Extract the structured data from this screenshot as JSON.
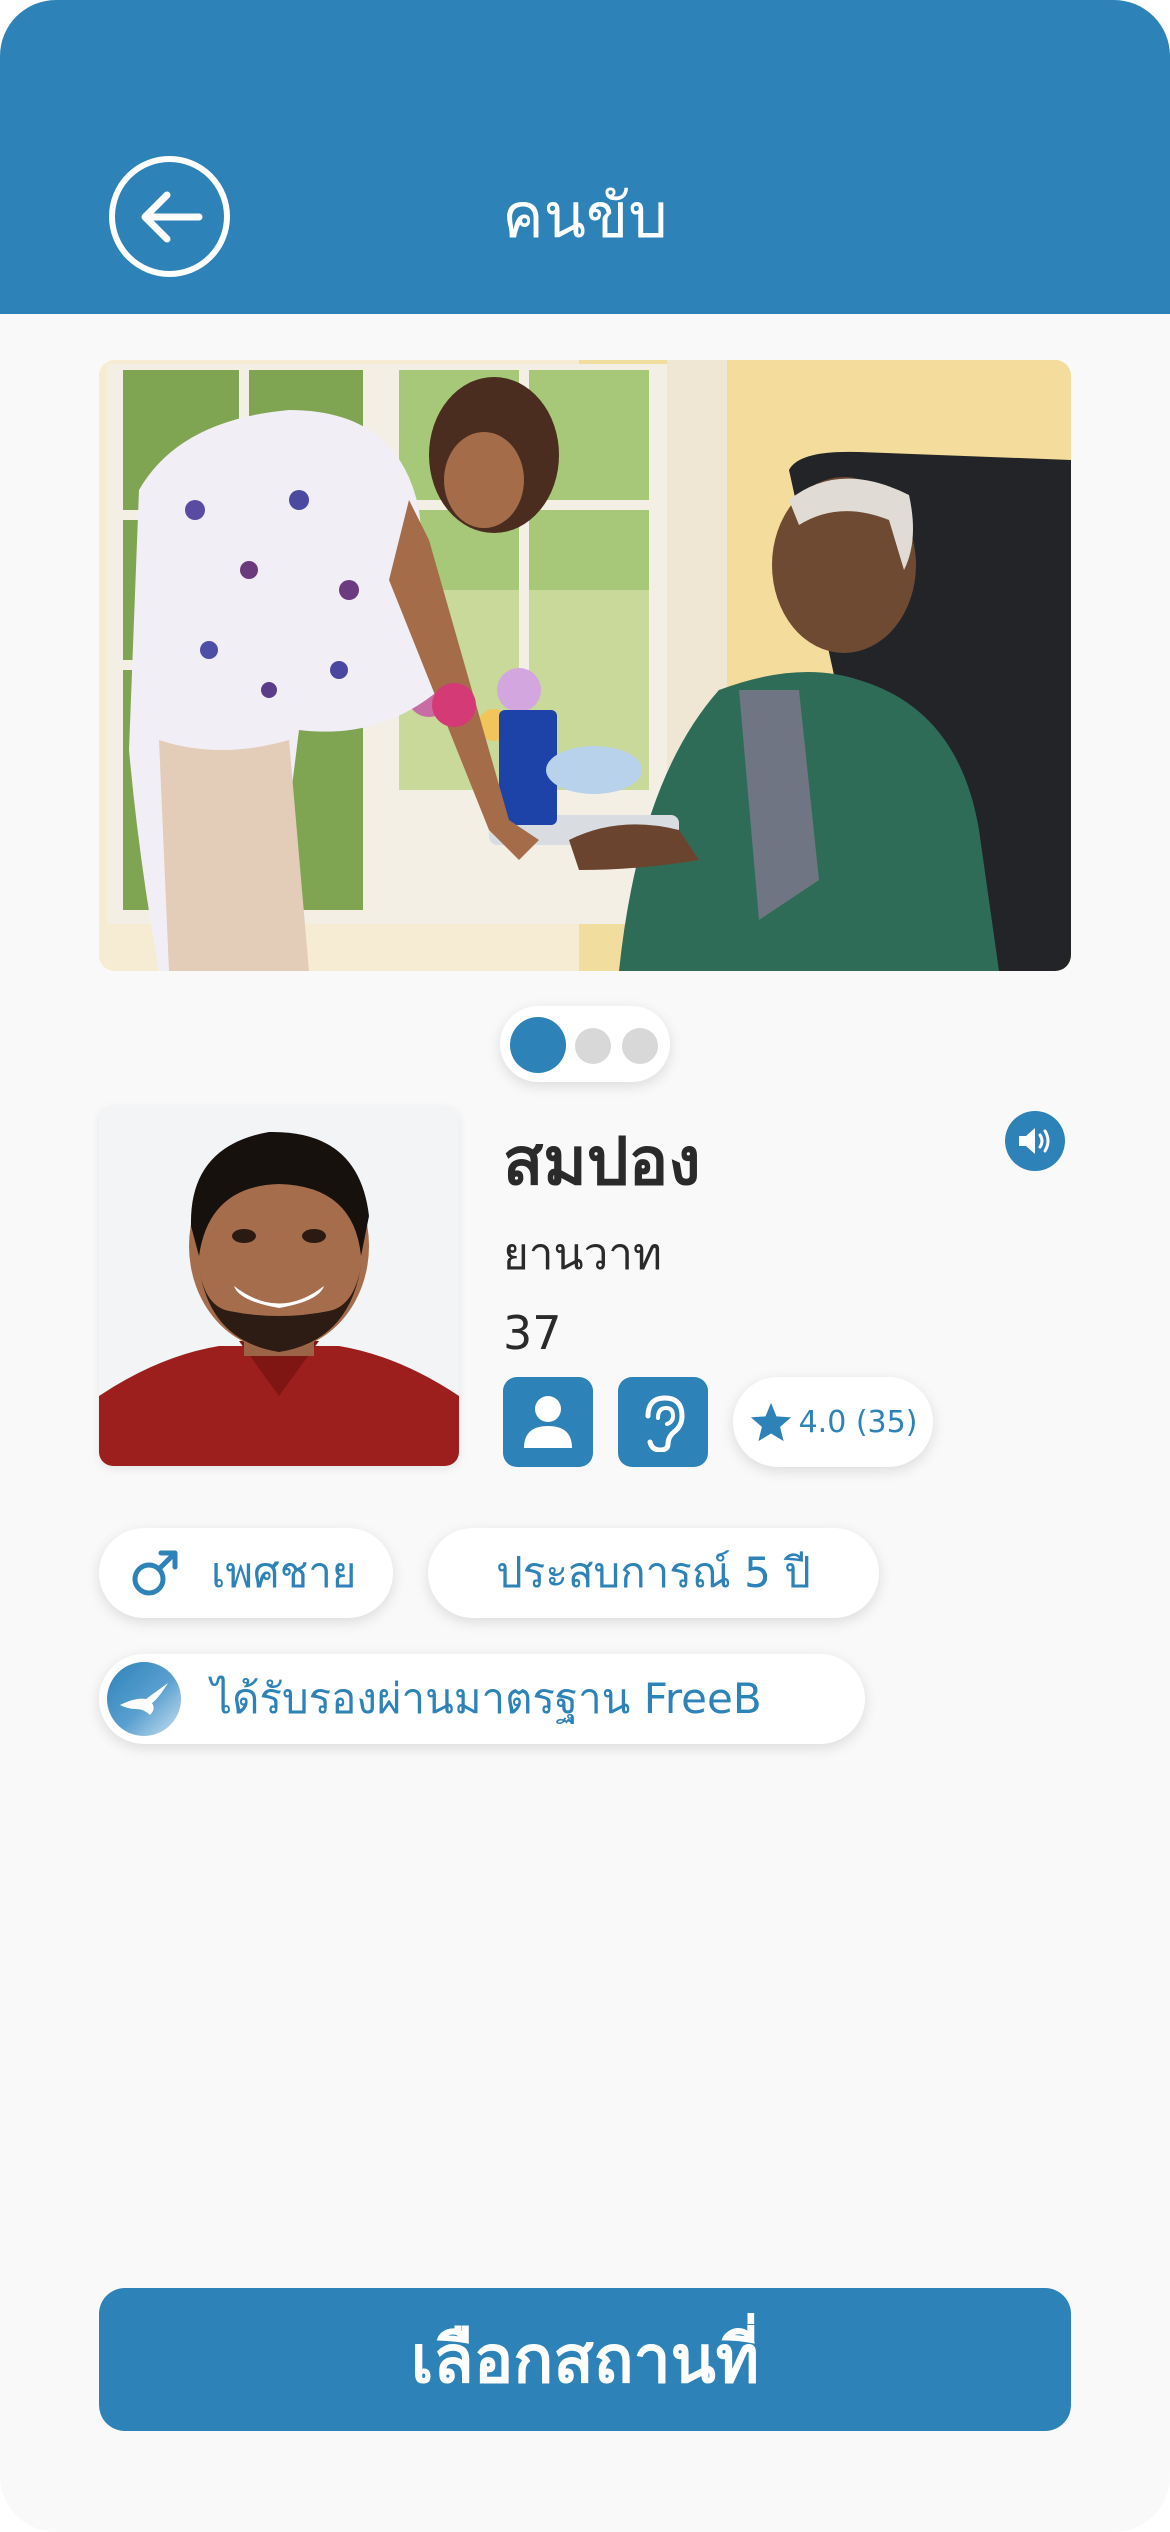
{
  "header": {
    "title": "คนขับ",
    "back_icon": "arrow-left-circle-icon"
  },
  "carousel": {
    "total": 3,
    "active": 1
  },
  "driver": {
    "name": "สมปอง",
    "vehicle": "ยานวาท",
    "age": "37",
    "rating": "4.0 (35)",
    "gender": "เพศชาย",
    "experience": "ประสบการณ์ 5 ปี",
    "certification": "ได้รับรองผ่านมาตรฐาน FreeB"
  },
  "features": [
    "person-icon",
    "hearing-ear-icon"
  ],
  "cta": {
    "label": "เลือกสถานที่"
  },
  "colors": {
    "primary": "#2d82b7",
    "background": "#f9f9f9",
    "inactive_dot": "#d8d8d8"
  }
}
